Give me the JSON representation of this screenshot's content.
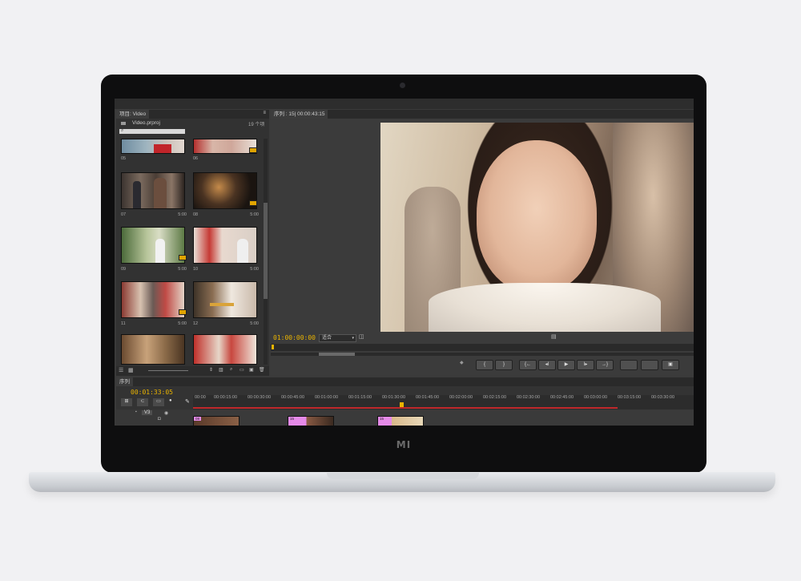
{
  "device": {
    "brand": "MI"
  },
  "project_panel": {
    "tab": "项目: Video",
    "file": "Video.prproj",
    "count": "19 个项",
    "search_placeholder": "",
    "items": [
      {
        "name": "05",
        "duration": "5:00"
      },
      {
        "name": "06",
        "duration": "5:00"
      },
      {
        "name": "07",
        "duration": "5:00"
      },
      {
        "name": "08",
        "duration": "5:00"
      },
      {
        "name": "09",
        "duration": "5:00"
      },
      {
        "name": "10",
        "duration": "5:00"
      },
      {
        "name": "11",
        "duration": "5:00"
      },
      {
        "name": "12",
        "duration": "5:00"
      },
      {
        "name": "",
        "duration": ""
      },
      {
        "name": "",
        "duration": ""
      }
    ]
  },
  "program_monitor": {
    "tab": "序列 : 15| 00:00:43:15",
    "timecode": "01:00:00:00",
    "fit": "适合",
    "controls": [
      "{",
      "}",
      "{←",
      "◂I",
      "▶",
      "I▸",
      "→}",
      "",
      "",
      "📷"
    ]
  },
  "timeline": {
    "tab": "序列",
    "timecode": "00:01:33:05",
    "ruler": [
      "00:00",
      "00:00:15:00",
      "00:00:30:00",
      "00:00:45:00",
      "00:01:00:00",
      "00:01:15:00",
      "00:01:30:00",
      "00:01:45:00",
      "00:02:00:00",
      "00:02:15:00",
      "00:02:30:00",
      "00:02:45:00",
      "00:03:00:00",
      "00:03:15:00",
      "00:03:30:00"
    ],
    "track": "V3",
    "clips": [
      {
        "label": "08"
      },
      {
        "label": "15"
      },
      {
        "label": "15"
      }
    ]
  },
  "colors": {
    "timecode": "#e9b300",
    "clip": "#e58ae8",
    "playhead": "#e9b300",
    "work_area": "#c0282b"
  }
}
